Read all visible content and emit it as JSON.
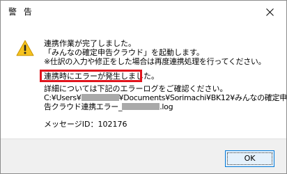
{
  "window": {
    "title": "警 告",
    "close_symbol": "✕"
  },
  "icon": {
    "name": "warning-icon",
    "fill_color": "#f6c31f",
    "stroke_color": "#d09d00"
  },
  "message": {
    "line1": "連携作業が完了しました。",
    "line2": "「みんなの確定申告クラウド」を起動します。",
    "line3": "※仕訳の入力や修正をした場合は再度連携処理を行ってください。",
    "error_highlight": "連携時にエラーが発生しました。",
    "detail_line": "詳細については下記のエラーログをご確認ください。",
    "path_prefix": "C:¥Users¥",
    "path_middle": "¥Documents¥Sorimachi¥BK12¥みんなの確定申",
    "path_line2_prefix": "告クラウド連携エラー_",
    "path_line2_suffix": ".log",
    "message_id": "メッセージID：102176"
  },
  "buttons": {
    "ok_label": "OK"
  },
  "colors": {
    "highlight_border": "#e0141c",
    "ok_border": "#0078d7",
    "ok_background": "#e5f1fb",
    "footer_background": "#f0f0f0"
  }
}
